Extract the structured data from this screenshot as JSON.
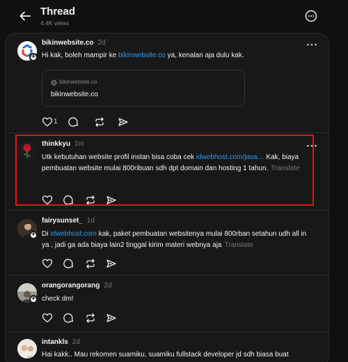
{
  "header": {
    "title": "Thread",
    "views": "4.4K views"
  },
  "posts": [
    {
      "username": "bikinwebsite.co",
      "age": "2d",
      "text_before": "Hi kak, boleh mampir ke ",
      "link": "bikinwebsite.co",
      "text_after": " ya, kenalan aja dulu kak.",
      "card": {
        "domain": "bikinwebsite.co",
        "title": "bikinwebsite.co"
      },
      "like_count": "1"
    },
    {
      "username": "thinkkyu",
      "age": "1m",
      "text_before": "Utk kebutuhan website profil instan bisa coba cek ",
      "link": "idwebhost.com/jasa…",
      "text_after": " Kak, biaya pembuatan website mulai 800ribuan sdh dpt domain dan hosting 1 tahun.",
      "translate": "Translate"
    },
    {
      "username": "fairysunset_",
      "age": "1d",
      "text_before": "Di ",
      "link": "idwebhost.com",
      "text_after": " kak, paket pembuatan websitenya mulai 800rban setahun udh all in ya , jadi ga ada biaya lain2 tinggal kirim materi webnya aja",
      "translate": "Translate"
    },
    {
      "username": "orangorangorang",
      "age": "2d",
      "text": "check dm!"
    },
    {
      "username": "intankls",
      "age": "2d",
      "text": "Hai kakk.. Mau rekomen suamiku, suamiku fullstack developer jd sdh biasa buat"
    }
  ]
}
